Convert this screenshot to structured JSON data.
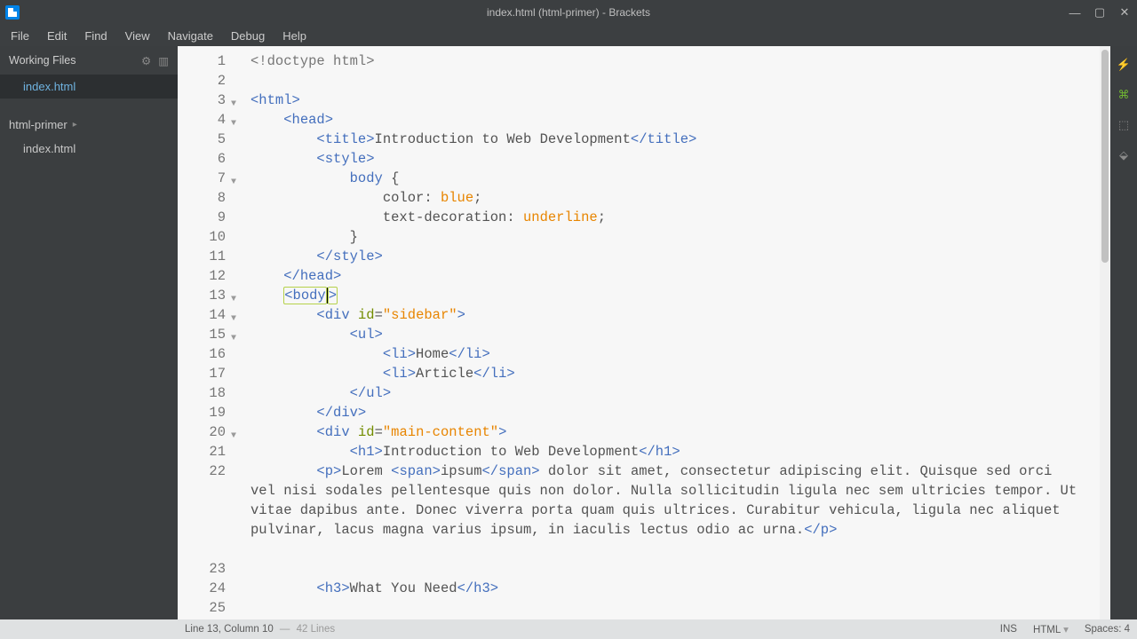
{
  "window": {
    "title": "index.html (html-primer) - Brackets"
  },
  "menu": [
    "File",
    "Edit",
    "Find",
    "View",
    "Navigate",
    "Debug",
    "Help"
  ],
  "sidebar": {
    "working_files_label": "Working Files",
    "working_files": [
      "index.html"
    ],
    "project_name": "html-primer",
    "project_files": [
      "index.html"
    ]
  },
  "gutter": {
    "lines": [
      "1",
      "2",
      "3",
      "4",
      "5",
      "6",
      "7",
      "8",
      "9",
      "10",
      "11",
      "12",
      "13",
      "14",
      "15",
      "16",
      "17",
      "18",
      "19",
      "20",
      "21",
      "22",
      "23",
      "24",
      "25"
    ],
    "fold_lines": [
      3,
      4,
      7,
      13,
      14,
      15,
      20
    ]
  },
  "code": {
    "l1_doctype": "<!doctype html>",
    "l3_html_open": "<html",
    "l3_gt": ">",
    "l4_head_open": "<head",
    "l4_gt": ">",
    "l5_title_open": "<title",
    "l5_gt": ">",
    "l5_text": "Introduction to Web Development",
    "l5_title_close": "</title>",
    "l6_style_open": "<style",
    "l6_gt": ">",
    "l7_sel": "body",
    "l7_brace": " {",
    "l8_prop": "color",
    "l8_colon": ": ",
    "l8_val": "blue",
    "l8_semi": ";",
    "l9_prop": "text-decoration",
    "l9_colon": ": ",
    "l9_val": "underline",
    "l9_semi": ";",
    "l10_brace": "}",
    "l11_style_close": "</style>",
    "l12_head_close": "</head>",
    "l13_body_open": "<body",
    "l13_gt": ">",
    "l14_div_open": "<div",
    "l14_sp": " ",
    "l14_attr": "id",
    "l14_eq": "=",
    "l14_str": "\"sidebar\"",
    "l14_gt": ">",
    "l15_ul_open": "<ul",
    "l15_gt": ">",
    "l16_li_open": "<li",
    "l16_gt": ">",
    "l16_text": "Home",
    "l16_li_close": "</li>",
    "l17_li_open": "<li",
    "l17_gt": ">",
    "l17_text": "Article",
    "l17_li_close": "</li>",
    "l18_ul_close": "</ul>",
    "l19_div_close": "</div>",
    "l20_div_open": "<div",
    "l20_sp": " ",
    "l20_attr": "id",
    "l20_eq": "=",
    "l20_str": "\"main-content\"",
    "l20_gt": ">",
    "l21_h1_open": "<h1",
    "l21_gt": ">",
    "l21_text": "Introduction to Web Development",
    "l21_h1_close": "</h1>",
    "l22_p_open": "<p",
    "l22_gt": ">",
    "l22_t1": "Lorem ",
    "l22_span_open": "<span",
    "l22_span_gt": ">",
    "l22_tspan": "ipsum",
    "l22_span_close": "</span>",
    "l22_t2": " dolor sit amet, consectetur adipiscing elit. Quisque sed orci   vel nisi sodales pellentesque quis non dolor. Nulla sollicitudin ligula nec sem ultricies tempor. Ut vitae dapibus ante. Donec viverra porta quam quis ultrices. Curabitur vehicula, ligula nec aliquet pulvinar, lacus magna varius ipsum, in iaculis lectus odio ac urna.",
    "l22_p_close": "</p>",
    "l24_h3_open": "<h3",
    "l24_gt": ">",
    "l24_text": "What You Need",
    "l24_h3_close": "</h3>"
  },
  "status": {
    "cursor": "Line 13, Column 10",
    "sep": " — ",
    "total": "42 Lines",
    "ins": "INS",
    "lang": "HTML",
    "lang_chev": "▾",
    "spaces": "Spaces: 4"
  },
  "icons": {
    "min": "—",
    "max": "▢",
    "close": "✕",
    "gear": "⚙",
    "split": "▥",
    "chev": "▸",
    "bolt": "⚡",
    "tree": "⌘",
    "ext": "⬚",
    "plug": "⬙"
  }
}
